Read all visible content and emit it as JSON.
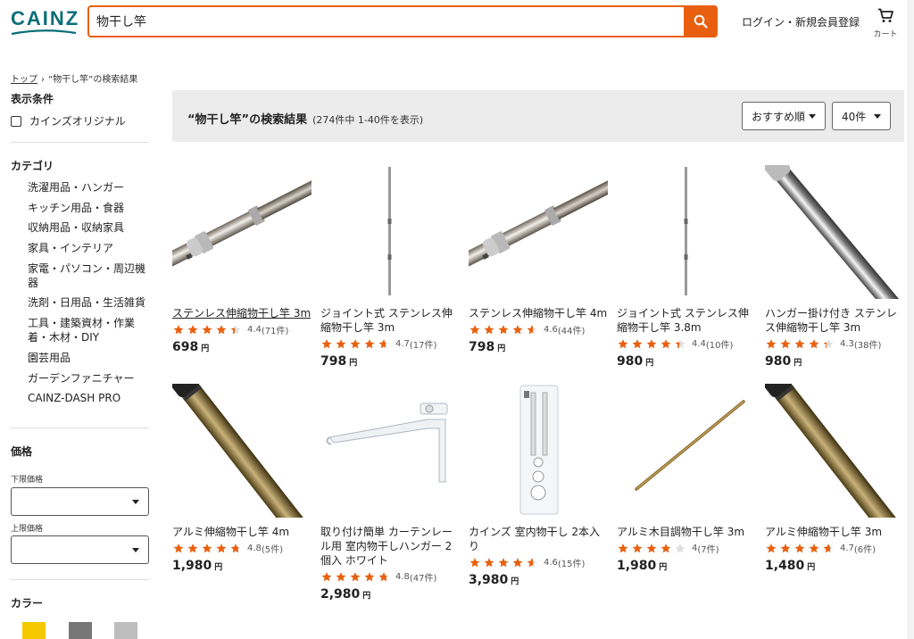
{
  "header": {
    "logo": "CAINZ",
    "search_value": "物干し竿",
    "login_label": "ログイン・新規会員登録",
    "cart_label": "カート"
  },
  "breadcrumb": {
    "home": "トップ",
    "current": "“物干し竿”の検索結果"
  },
  "filters": {
    "display_heading": "表示条件",
    "cainz_original": "カインズオリジナル",
    "category_heading": "カテゴリ",
    "categories": [
      "洗濯用品・ハンガー",
      "キッチン用品・食器",
      "収納用品・収納家具",
      "家具・インテリア",
      "家電・パソコン・周辺機器",
      "洗剤・日用品・生活雑貨",
      "工具・建築資材・作業着・木材・DIY",
      "園芸用品",
      "ガーデンファニチャー",
      "CAINZ-DASH PRO"
    ],
    "price_heading": "価格",
    "min_price_label": "下限価格",
    "max_price_label": "上限価格",
    "color_heading": "カラー",
    "colors": [
      "#f5c800",
      "#777777",
      "#bdbdbd"
    ]
  },
  "results": {
    "title": "“物干し竿”の検索結果",
    "count_text": "(274件中 1-40件を表示)",
    "sort_label": "おすすめ順",
    "per_page_label": "40件"
  },
  "accent_color": "#e8600f",
  "products": [
    {
      "name": "ステンレス伸縮物干し竿 3m",
      "rating": 4.4,
      "rating_text": "4.4",
      "reviews": "(71件)",
      "price": "698",
      "image": "stainless-pole-icon"
    },
    {
      "name": "ジョイント式 ステンレス伸縮物干し竿 3m",
      "rating": 4.7,
      "rating_text": "4.7",
      "reviews": "(17件)",
      "price": "798",
      "image": "vertical-rod-icon"
    },
    {
      "name": "ステンレス伸縮物干し竿 4m",
      "rating": 4.6,
      "rating_text": "4.6",
      "reviews": "(44件)",
      "price": "798",
      "image": "stainless-pole-icon"
    },
    {
      "name": "ジョイント式 ステンレス伸縮物干し竿 3.8m",
      "rating": 4.4,
      "rating_text": "4.4",
      "reviews": "(10件)",
      "price": "980",
      "image": "vertical-rod-icon"
    },
    {
      "name": "ハンガー掛け付き ステンレス伸縮物干し竿 3m",
      "rating": 4.3,
      "rating_text": "4.3",
      "reviews": "(38件)",
      "price": "980",
      "image": "chrome-pole-icon"
    },
    {
      "name": "アルミ伸縮物干し竿 4m",
      "rating": 4.8,
      "rating_text": "4.8",
      "reviews": "(5件)",
      "price": "1,980",
      "image": "bronze-pole-icon"
    },
    {
      "name": "取り付け簡単 カーテンレール用 室内物干しハンガー 2個入 ホワイト",
      "rating": 4.8,
      "rating_text": "4.8",
      "reviews": "(47件)",
      "price": "2,980",
      "image": "white-bracket-icon"
    },
    {
      "name": "カインズ 室内物干し 2本入り",
      "rating": 4.6,
      "rating_text": "4.6",
      "reviews": "(15件)",
      "price": "3,980",
      "image": "package-icon"
    },
    {
      "name": "アルミ木目調物干し竿 3m",
      "rating": 4.0,
      "rating_text": "4",
      "reviews": "(7件)",
      "price": "1,980",
      "image": "wood-rod-icon"
    },
    {
      "name": "アルミ伸縮物干し竿 3m",
      "rating": 4.7,
      "rating_text": "4.7",
      "reviews": "(6件)",
      "price": "1,480",
      "image": "bronze-pole-icon"
    }
  ],
  "currency_unit": "円"
}
